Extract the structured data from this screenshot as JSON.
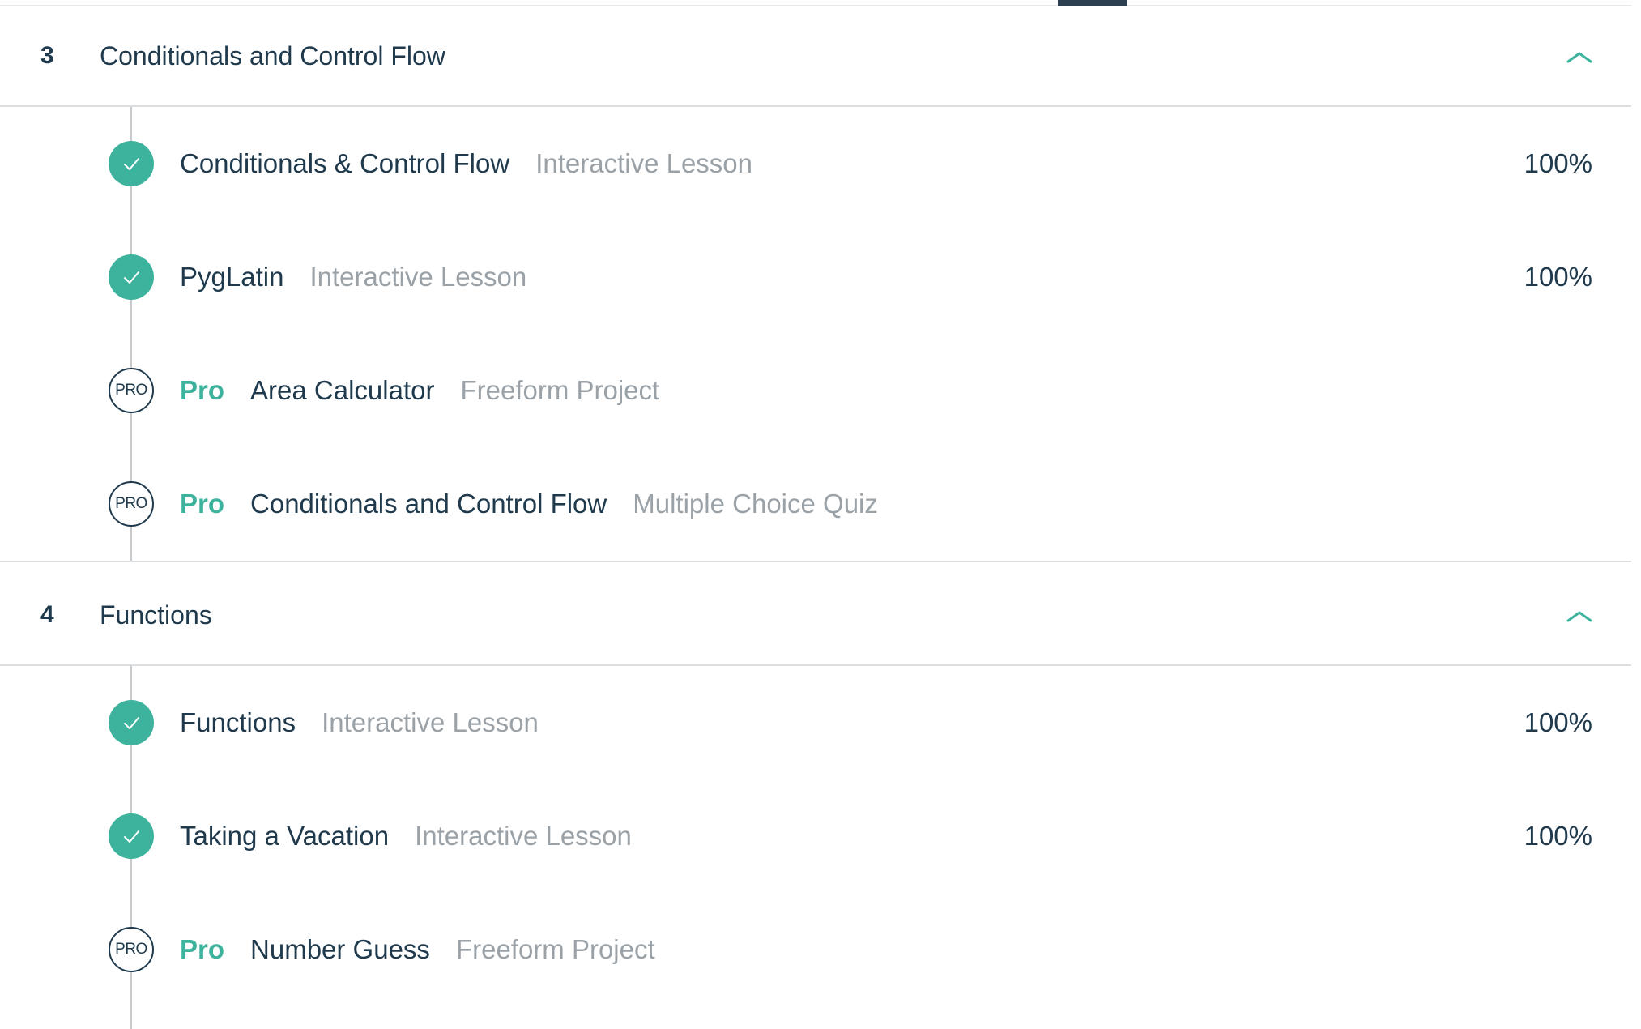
{
  "colors": {
    "accent": "#3db39e",
    "text_primary": "#1f3a4d",
    "text_muted": "#9aa2a8",
    "divider": "#dcdfe2"
  },
  "modules": [
    {
      "number": "3",
      "title": "Conditionals and Control Flow",
      "collapse_icon": "chevron-up-icon",
      "items": [
        {
          "status": "complete",
          "pro_badge": "",
          "pro_label": "",
          "title": "Conditionals & Control Flow",
          "type": "Interactive Lesson",
          "progress": "100%"
        },
        {
          "status": "complete",
          "pro_badge": "",
          "pro_label": "",
          "title": "PygLatin",
          "type": "Interactive Lesson",
          "progress": "100%"
        },
        {
          "status": "pro",
          "pro_badge": "PRO",
          "pro_label": "Pro",
          "title": "Area Calculator",
          "type": "Freeform Project",
          "progress": ""
        },
        {
          "status": "pro",
          "pro_badge": "PRO",
          "pro_label": "Pro",
          "title": "Conditionals and Control Flow",
          "type": "Multiple Choice Quiz",
          "progress": ""
        }
      ]
    },
    {
      "number": "4",
      "title": "Functions",
      "collapse_icon": "chevron-up-icon",
      "items": [
        {
          "status": "complete",
          "pro_badge": "",
          "pro_label": "",
          "title": "Functions",
          "type": "Interactive Lesson",
          "progress": "100%"
        },
        {
          "status": "complete",
          "pro_badge": "",
          "pro_label": "",
          "title": "Taking a Vacation",
          "type": "Interactive Lesson",
          "progress": "100%"
        },
        {
          "status": "pro",
          "pro_badge": "PRO",
          "pro_label": "Pro",
          "title": "Number Guess",
          "type": "Freeform Project",
          "progress": ""
        }
      ]
    }
  ]
}
